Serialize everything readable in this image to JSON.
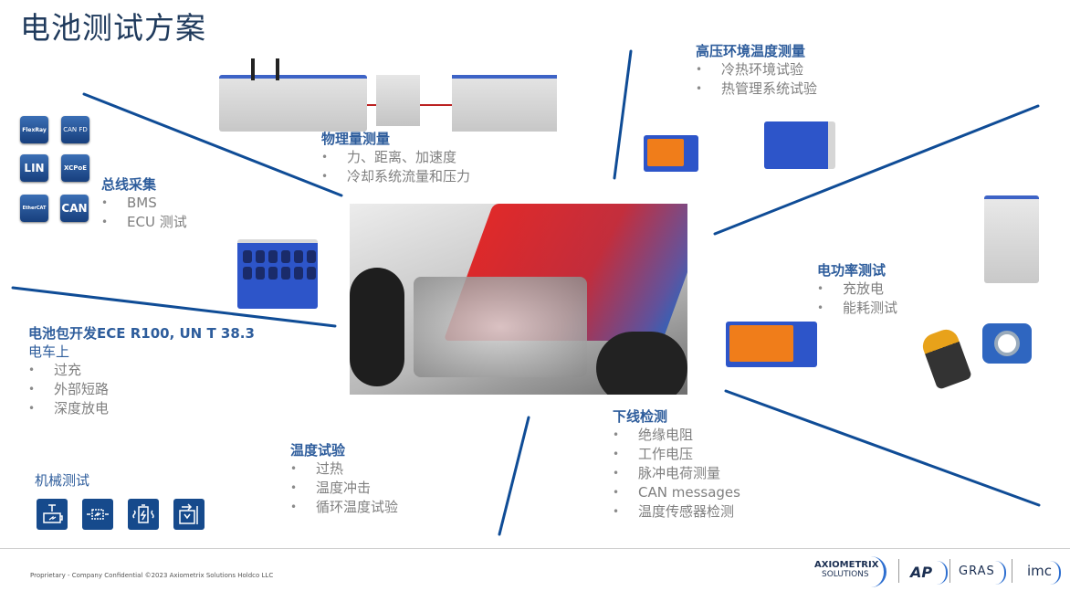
{
  "title": "电池测试方案",
  "sections": {
    "bus": {
      "heading": "总线采集",
      "bullets": [
        "BMS",
        "ECU 测试"
      ]
    },
    "physical": {
      "heading": "物理量测量",
      "bullets": [
        "力、距离、加速度",
        "冷却系统流量和压力"
      ]
    },
    "hv_temp": {
      "heading": "高压环境温度测量",
      "bullets": [
        "冷热环境试验",
        "热管理系统试验"
      ]
    },
    "power": {
      "heading": "电功率测试",
      "bullets": [
        "充放电",
        "能耗测试"
      ]
    },
    "pack": {
      "heading": "电池包开发ECE R100, UN T 38.3",
      "subheading": "电车上",
      "bullets": [
        "过充",
        "外部短路",
        "深度放电"
      ]
    },
    "temp": {
      "heading": "温度试验",
      "bullets": [
        "过热",
        "温度冲击",
        "循环温度试验"
      ]
    },
    "eol": {
      "heading": "下线检测",
      "bullets": [
        "绝缘电阻",
        "工作电压",
        "脉冲电荷测量",
        "CAN messages",
        "温度传感器检测"
      ]
    },
    "mech": {
      "heading": "机械测试"
    }
  },
  "bus_icons": [
    {
      "label": "FlexRay",
      "icon": "flexray-icon"
    },
    {
      "label": "CAN FD",
      "icon": "canfd-icon"
    },
    {
      "label": "LIN",
      "icon": "lin-icon"
    },
    {
      "label": "XCPoE",
      "icon": "xcpoe-icon"
    },
    {
      "label": "EtherCAT",
      "icon": "ethercat-icon"
    },
    {
      "label": "CAN",
      "icon": "can-icon"
    }
  ],
  "mech_icons": [
    "crush-test-icon",
    "compression-test-icon",
    "vibration-test-icon",
    "penetration-test-icon"
  ],
  "footer": {
    "copyright": "Proprietary - Company Confidential ©2023 Axiometrix Solutions Holdco LLC",
    "logos": {
      "axio1": "AXIOMETRIX",
      "axio2": "SOLUTIONS",
      "ap": "AP",
      "gras": "GRAS",
      "imc": "imc"
    }
  },
  "colors": {
    "accent": "#2e5d9c",
    "line": "#0f4c96",
    "title": "#1f3a5c",
    "bullet": "#7f7f7f"
  }
}
